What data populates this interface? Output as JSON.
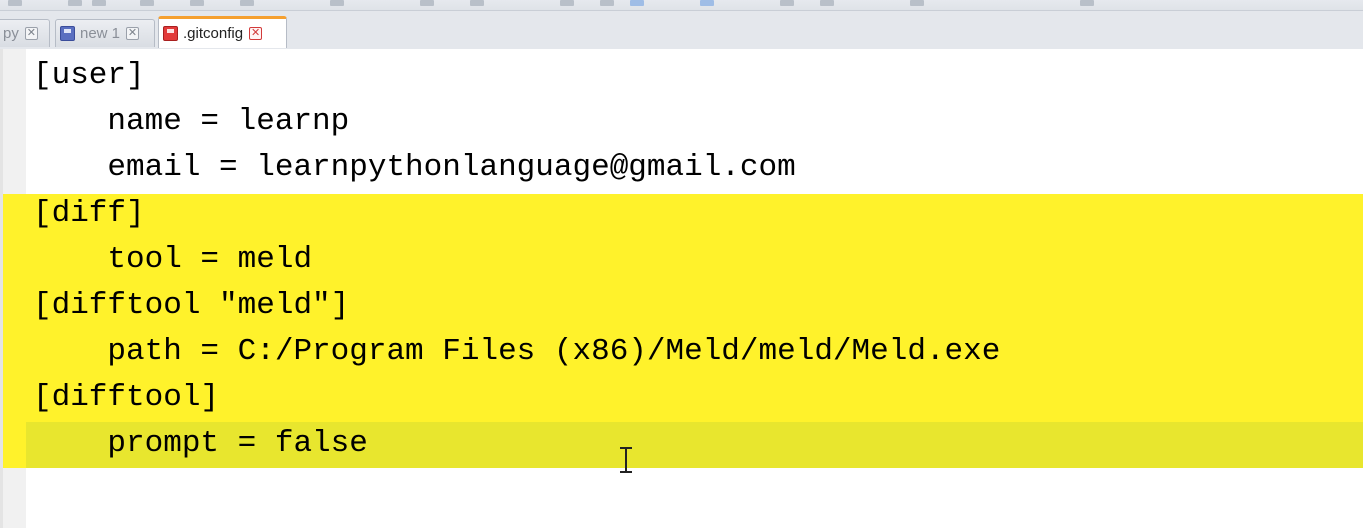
{
  "tabs": [
    {
      "label": "py",
      "state": "inactive"
    },
    {
      "label": "new 1",
      "state": "inactive"
    },
    {
      "label": ".gitconfig",
      "state": "active"
    }
  ],
  "editor": {
    "lines": [
      "[user]",
      "    name = learnp",
      "    email = learnpythonlanguage@gmail.com",
      "[diff]",
      "    tool = meld",
      "[difftool \"meld\"]",
      "    path = C:/Program Files (x86)/Meld/meld/Meld.exe",
      "[difftool]",
      "    prompt = false"
    ],
    "selected_lines": "4-9",
    "current_line": 9
  },
  "colors": {
    "selection_highlight": "#fff22b",
    "current_line_highlight": "#e8e62e",
    "active_tab_accent": "#f5a030",
    "unsaved_icon": "#e23a3a",
    "saved_icon": "#5a6fc0"
  },
  "icons": {
    "tab_saved": "save-disk-icon",
    "tab_unsaved": "unsaved-disk-icon",
    "tab_close": "close-icon",
    "cursor": "text-cursor-icon"
  }
}
